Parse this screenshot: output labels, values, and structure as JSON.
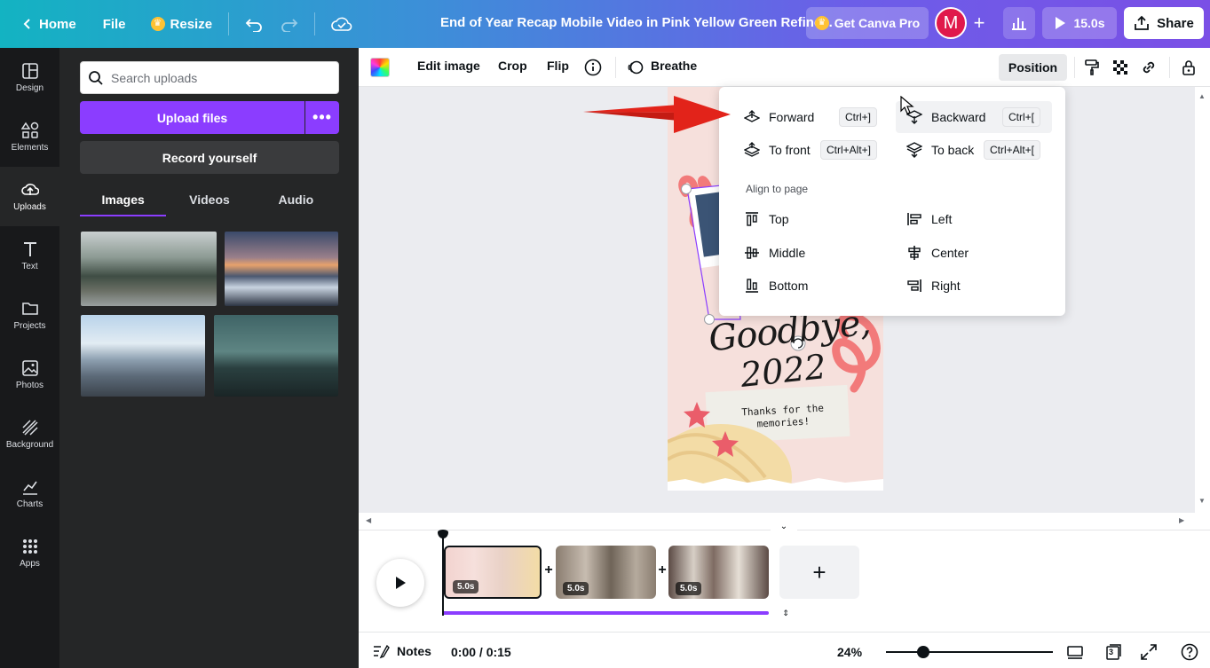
{
  "topbar": {
    "home": "Home",
    "file": "File",
    "resize": "Resize",
    "title": "End of Year Recap Mobile Video in Pink Yellow Green Refine...",
    "pro": "Get Canva Pro",
    "avatar": "M",
    "duration": "15.0s",
    "share": "Share"
  },
  "rail": {
    "items": [
      {
        "label": "Design"
      },
      {
        "label": "Elements"
      },
      {
        "label": "Uploads"
      },
      {
        "label": "Text"
      },
      {
        "label": "Projects"
      },
      {
        "label": "Photos"
      },
      {
        "label": "Background"
      },
      {
        "label": "Charts"
      },
      {
        "label": "Apps"
      }
    ]
  },
  "panel": {
    "search_placeholder": "Search uploads",
    "upload": "Upload files",
    "more": "•••",
    "record": "Record yourself",
    "tabs": [
      "Images",
      "Videos",
      "Audio"
    ]
  },
  "toolbar": {
    "edit_image": "Edit image",
    "crop": "Crop",
    "flip": "Flip",
    "animate": "Breathe",
    "position": "Position"
  },
  "position_menu": {
    "forward": "Forward",
    "forward_key": "Ctrl+]",
    "backward": "Backward",
    "backward_key": "Ctrl+[",
    "to_front": "To front",
    "to_front_key": "Ctrl+Alt+]",
    "to_back": "To back",
    "to_back_key": "Ctrl+Alt+[",
    "align_heading": "Align to page",
    "top": "Top",
    "left": "Left",
    "middle": "Middle",
    "center": "Center",
    "bottom": "Bottom",
    "right": "Right"
  },
  "page": {
    "headline_1": "Goodbye,",
    "headline_2": "2022",
    "note": "Thanks for the memories!"
  },
  "timeline": {
    "clips": [
      {
        "duration": "5.0s"
      },
      {
        "duration": "5.0s"
      },
      {
        "duration": "5.0s"
      }
    ],
    "add": "+",
    "progress": 1.0
  },
  "bottombar": {
    "notes": "Notes",
    "time": "0:00 / 0:15",
    "zoom": "24%",
    "pages": "3"
  },
  "colors": {
    "accent": "#8b3dff",
    "avatar": "#e0194b"
  }
}
